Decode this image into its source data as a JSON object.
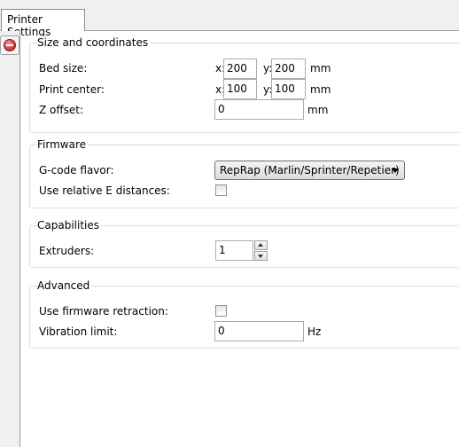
{
  "tab": {
    "label": "Printer Settings"
  },
  "sections": {
    "size": {
      "title": "Size and coordinates",
      "bed_size": {
        "label": "Bed size:",
        "x_axis": "x:",
        "x": "200",
        "y_axis": "y:",
        "y": "200",
        "unit": "mm"
      },
      "print_center": {
        "label": "Print center:",
        "x_axis": "x:",
        "x": "100",
        "y_axis": "y:",
        "y": "100",
        "unit": "mm"
      },
      "z_offset": {
        "label": "Z offset:",
        "value": "0",
        "unit": "mm"
      }
    },
    "firmware": {
      "title": "Firmware",
      "gcode_flavor": {
        "label": "G-code flavor:",
        "value": "RepRap (Marlin/Sprinter/Repetier)"
      },
      "relative_e": {
        "label": "Use relative E distances:",
        "checked": false
      }
    },
    "capabilities": {
      "title": "Capabilities",
      "extruders": {
        "label": "Extruders:",
        "value": "1"
      }
    },
    "advanced": {
      "title": "Advanced",
      "firmware_retraction": {
        "label": "Use firmware retraction:",
        "checked": false
      },
      "vibration_limit": {
        "label": "Vibration limit:",
        "value": "0",
        "unit": "Hz"
      }
    }
  },
  "icons": {
    "remove": "remove-icon"
  }
}
